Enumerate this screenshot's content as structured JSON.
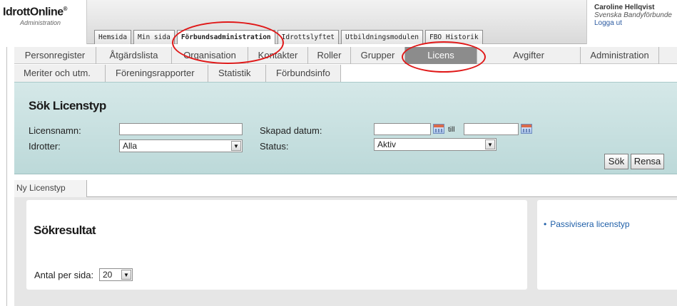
{
  "logo": {
    "title": "IdrottOnline",
    "mark": "®",
    "subtitle": "Administration"
  },
  "user": {
    "name": "Caroline Hellqvist",
    "org": "Svenska Bandyförbunde",
    "logout": "Logga ut"
  },
  "top_tabs": [
    {
      "label": "Hemsida"
    },
    {
      "label": "Min sida"
    },
    {
      "label": "Förbundsadministration",
      "active": true
    },
    {
      "label": "Idrottslyftet"
    },
    {
      "label": "Utbildningsmodulen"
    },
    {
      "label": "FBO Historik"
    }
  ],
  "nav_row1": [
    {
      "label": "Personregister"
    },
    {
      "label": "Åtgärdslista"
    },
    {
      "label": "Organisation"
    },
    {
      "label": "Kontakter"
    },
    {
      "label": "Roller"
    },
    {
      "label": "Grupper"
    },
    {
      "label": "Licens",
      "active": true
    },
    {
      "label": "Avgifter"
    },
    {
      "label": "Administration"
    }
  ],
  "nav_row2": [
    {
      "label": "Meriter och utm."
    },
    {
      "label": "Föreningsrapporter"
    },
    {
      "label": "Statistik"
    },
    {
      "label": "Förbundsinfo"
    }
  ],
  "search": {
    "title": "Sök Licenstyp",
    "licensnamn_label": "Licensnamn:",
    "licensnamn_value": "",
    "idrotter_label": "Idrotter:",
    "idrotter_value": "Alla",
    "skapad_label": "Skapad datum:",
    "skapad_from": "",
    "till_label": "till",
    "skapad_to": "",
    "status_label": "Status:",
    "status_value": "Aktiv",
    "search_button": "Sök",
    "clear_button": "Rensa"
  },
  "results": {
    "tab_label": "Ny Licenstyp",
    "title": "Sökresultat",
    "per_page_label": "Antal per sida:",
    "per_page_value": "20",
    "side_link": "Passivisera licenstyp"
  },
  "colors": {
    "search_panel": "#c6dfdf",
    "active_nav": "#8c8c8c",
    "link": "#1f5fa8",
    "annotation": "#e01818"
  },
  "icons": {
    "calendar": "calendar-icon",
    "dropdown": "chevron-down-icon"
  }
}
